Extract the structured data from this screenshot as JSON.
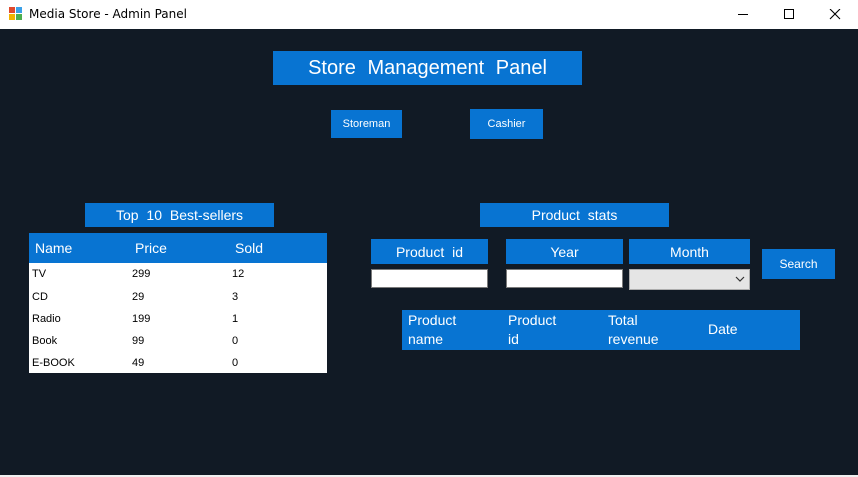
{
  "window": {
    "title": "Media Store - Admin Panel",
    "icon": "app-window-icon",
    "controls": [
      "minimize-icon",
      "maximize-icon",
      "close-icon"
    ]
  },
  "colors": {
    "background": "#111a25",
    "accent": "#0874d2",
    "text_on_accent": "#ffffff"
  },
  "main_title": "Store  Management  Panel",
  "nav": {
    "storeman": "Storeman",
    "cashier": "Cashier"
  },
  "bestsellers": {
    "title": "Top  10  Best-sellers",
    "columns": [
      "Name",
      "Price",
      "Sold"
    ],
    "rows": [
      [
        "TV",
        "299",
        "12"
      ],
      [
        "CD",
        "29",
        "3"
      ],
      [
        "Radio",
        "199",
        "1"
      ],
      [
        "Book",
        "99",
        "0"
      ],
      [
        "E-BOOK",
        "49",
        "0"
      ]
    ]
  },
  "stats": {
    "title": "Product  stats",
    "product_id_label": "Product  id",
    "year_label": "Year",
    "month_label": "Month",
    "product_id_value": "",
    "year_value": "",
    "month_value": "",
    "search_label": "Search",
    "results_columns": [
      [
        "Product",
        "name"
      ],
      [
        "Product",
        "id"
      ],
      [
        "Total",
        "revenue"
      ],
      [
        "Date"
      ]
    ]
  }
}
